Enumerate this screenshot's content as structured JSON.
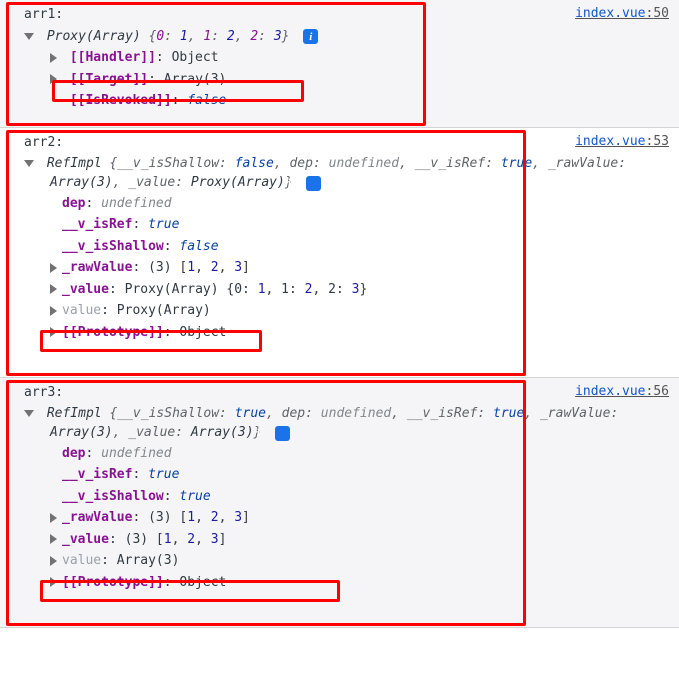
{
  "panels": [
    {
      "label": "arr1:",
      "source": {
        "file": "index.vue",
        "line": 50
      },
      "summary_prefix": "Proxy(Array)",
      "summary_body": "{0: 1, 1: 1, 2: 2, 2: 3}",
      "rows": [
        {
          "tri": "right",
          "prop": "[[Handler]]",
          "sep": ": ",
          "val": "Object",
          "valclass": "val-obj"
        },
        {
          "tri": "right",
          "prop": "[[Target]]",
          "sep": ": ",
          "val": "Array(3)",
          "valclass": "val-obj",
          "box": true
        },
        {
          "tri": "spacer",
          "prop": "[[IsRevoked]]",
          "sep": ": ",
          "val": "false",
          "valclass": "val-bool"
        }
      ]
    },
    {
      "label": "arr2:",
      "source": {
        "file": "index.vue",
        "line": 53
      },
      "summary_text": "RefImpl {__v_isShallow: false, dep: undefined, __v_isRef: true, _rawValue: Array(3), _value: Proxy(Array)}",
      "rows": [
        {
          "tri": "spacer",
          "prop": "dep",
          "sep": ": ",
          "val": "undefined",
          "valclass": "val-und"
        },
        {
          "tri": "spacer",
          "prop": "__v_isRef",
          "sep": ": ",
          "val": "true",
          "valclass": "val-bool"
        },
        {
          "tri": "spacer",
          "prop": "__v_isShallow",
          "sep": ": ",
          "val": "false",
          "valclass": "val-bool"
        },
        {
          "tri": "right",
          "prop": "_rawValue",
          "sep": ": ",
          "val": "(3) [1, 2, 3]",
          "valclass": "val-obj",
          "arrvals": true
        },
        {
          "tri": "right",
          "prop": "_value",
          "sep": ": ",
          "val": "Proxy(Array) {0: 1, 1: 2, 2: 3}",
          "valclass": "val-obj",
          "keyed": true
        },
        {
          "tri": "right",
          "prop": "value",
          "propdim": true,
          "sep": ": ",
          "val": "Proxy(Array)",
          "valclass": "val-obj",
          "box": true
        },
        {
          "tri": "right",
          "prop": "[[Prototype]]",
          "sep": ": ",
          "val": "Object",
          "valclass": "val-obj"
        }
      ]
    },
    {
      "label": "arr3:",
      "source": {
        "file": "index.vue",
        "line": 56
      },
      "summary_text": "RefImpl {__v_isShallow: true, dep: undefined, __v_isRef: true, _rawValue: Array(3), _value: Array(3)}",
      "rows": [
        {
          "tri": "spacer",
          "prop": "dep",
          "sep": ": ",
          "val": "undefined",
          "valclass": "val-und"
        },
        {
          "tri": "spacer",
          "prop": "__v_isRef",
          "sep": ": ",
          "val": "true",
          "valclass": "val-bool"
        },
        {
          "tri": "spacer",
          "prop": "__v_isShallow",
          "sep": ": ",
          "val": "true",
          "valclass": "val-bool"
        },
        {
          "tri": "right",
          "prop": "_rawValue",
          "sep": ": ",
          "val": "(3) [1, 2, 3]",
          "valclass": "val-obj",
          "arrvals": true
        },
        {
          "tri": "right",
          "prop": "_value",
          "sep": ": ",
          "val": "(3) [1, 2, 3]",
          "valclass": "val-obj",
          "arrvals": true
        },
        {
          "tri": "right",
          "prop": "value",
          "propdim": true,
          "sep": ": ",
          "val": "Array(3)",
          "valclass": "val-obj",
          "box": true
        },
        {
          "tri": "right",
          "prop": "[[Prototype]]",
          "sep": ": ",
          "val": "Object",
          "valclass": "val-obj"
        }
      ]
    }
  ]
}
